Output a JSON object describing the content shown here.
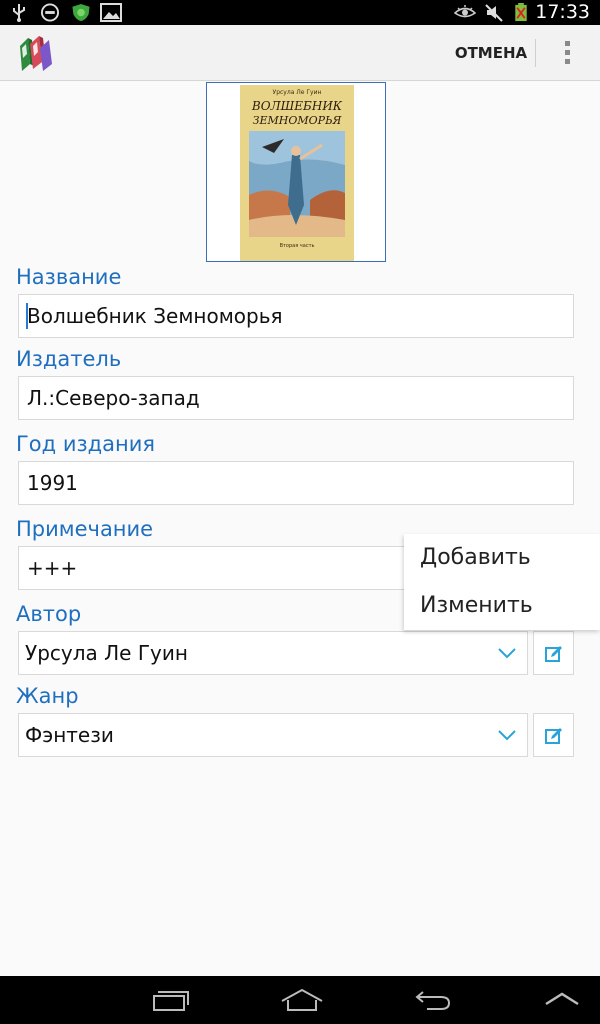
{
  "status_bar": {
    "time": "17:33",
    "left_icons": [
      "usb-icon",
      "block-icon",
      "shield-icon",
      "image-icon"
    ],
    "right_icons": [
      "eye-icon",
      "silent-icon",
      "battery-icon"
    ]
  },
  "action_bar": {
    "cancel_label": "ОТМЕНА",
    "overflow_icon": "overflow-menu-icon"
  },
  "cover": {
    "author_line": "Урсула Ле Гуин",
    "title_line1": "ВОЛШЕБНИК",
    "title_line2": "ЗЕМНОМОРЬЯ",
    "bottom_line": "Вторая часть"
  },
  "form": {
    "title_label": "Название",
    "title_value": "Волшебник Земноморья",
    "publisher_label": "Издатель",
    "publisher_value": "Л.:Северо-запад",
    "year_label": "Год издания",
    "year_value": "1991",
    "note_label": "Примечание",
    "note_value": "+++",
    "author_label": "Автор",
    "author_value": "Урсула Ле Гуин",
    "genre_label": "Жанр",
    "genre_value": "Фэнтези"
  },
  "popup_menu": {
    "items": [
      "Добавить",
      "Изменить"
    ]
  },
  "colors": {
    "accent": "#1f6fbf",
    "icon_accent": "#2aa3d8"
  }
}
